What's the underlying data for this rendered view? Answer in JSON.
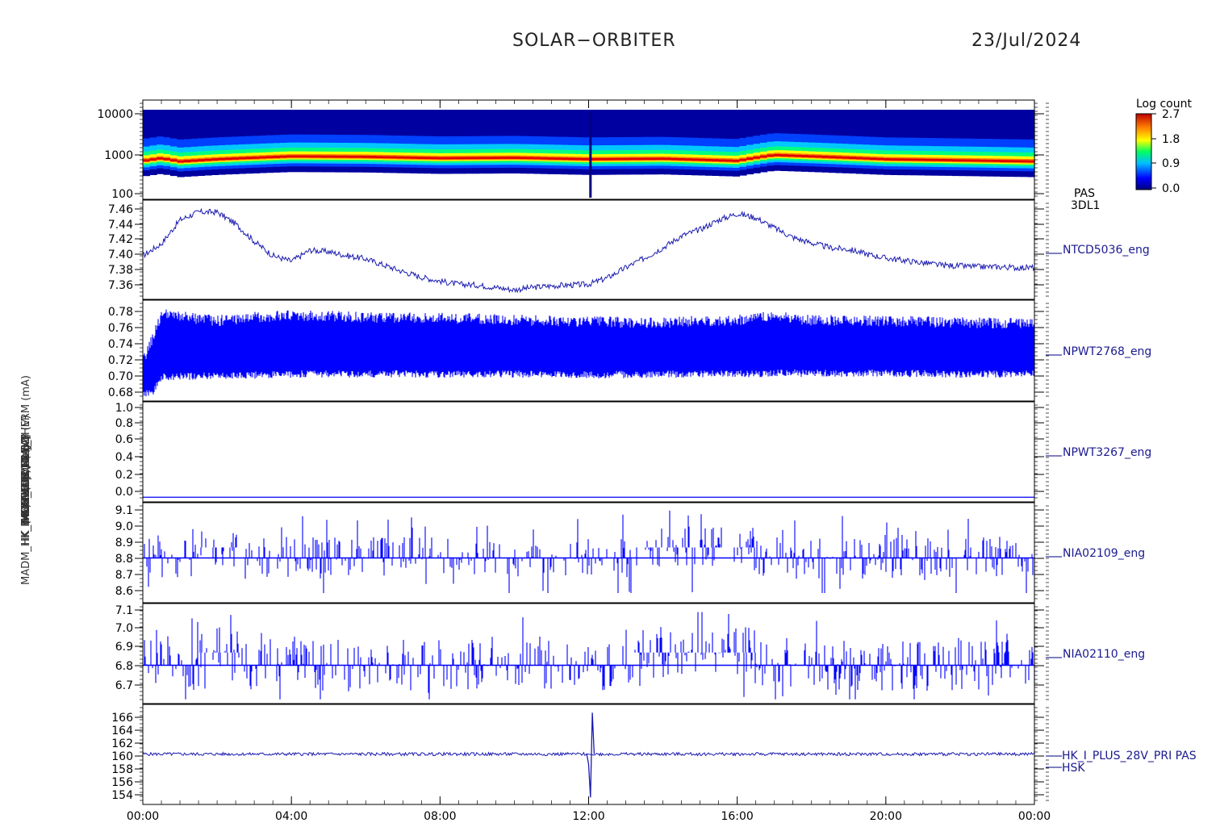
{
  "header": {
    "mission": "SOLAR−ORBITER",
    "date": "23/Jul/2024"
  },
  "y_axis_labels": [
    "(eV)",
    "Flux Temp (DegC)",
    "SW HDS 1 (A)",
    "T ERPW FDB0 (A)",
    "VA SWA 2 / 1 / 2",
    "(nF) C 1 (V) 1 (V)",
    "HK_IMON_FDR MLE_P (V)",
    "MADM_HK_IMON_FDR MLE_THERM (mA)"
  ],
  "x_ticks": [
    "00:00",
    "04:00",
    "08:00",
    "12:00",
    "16:00",
    "20:00",
    "00:00"
  ],
  "colorbar": {
    "title": "Log count",
    "ticks": [
      "2.7",
      "1.8",
      "0.9",
      "0.0"
    ]
  },
  "chart_data": [
    {
      "type": "heatmap",
      "panel_labels": [
        "PAS",
        "3DL1"
      ],
      "yscale": "log",
      "ylim": [
        100,
        15000
      ],
      "yticks": [
        "10000",
        "1000",
        "100"
      ],
      "zlim": [
        0.0,
        2.7
      ],
      "xlim_hours": [
        0,
        24
      ],
      "peak_energy_eV": [
        {
          "x": 0.0,
          "y": 700
        },
        {
          "x": 0.5,
          "y": 800
        },
        {
          "x": 1.0,
          "y": 680
        },
        {
          "x": 2.0,
          "y": 760
        },
        {
          "x": 4.0,
          "y": 880
        },
        {
          "x": 6.0,
          "y": 860
        },
        {
          "x": 8.0,
          "y": 800
        },
        {
          "x": 10.0,
          "y": 820
        },
        {
          "x": 12.0,
          "y": 760
        },
        {
          "x": 14.0,
          "y": 780
        },
        {
          "x": 16.0,
          "y": 700
        },
        {
          "x": 17.0,
          "y": 940
        },
        {
          "x": 20.0,
          "y": 760
        },
        {
          "x": 24.0,
          "y": 680
        }
      ],
      "color": "#000080"
    },
    {
      "type": "line",
      "panel_label": "NTCD5036_eng",
      "ylim": [
        7.345,
        7.47
      ],
      "yticks": [
        "7.46",
        "7.44",
        "7.42",
        "7.40",
        "7.38",
        "7.36"
      ],
      "series": [
        {
          "color": "#1a1ab0",
          "x": [
            0.0,
            0.5,
            1.0,
            1.5,
            2.0,
            2.5,
            3.0,
            3.5,
            4.0,
            4.5,
            5.0,
            5.5,
            6.0,
            6.5,
            7.0,
            7.5,
            8.0,
            8.5,
            9.0,
            9.5,
            10.0,
            10.5,
            11.0,
            11.5,
            12.0,
            12.5,
            13.0,
            13.5,
            14.0,
            14.5,
            15.0,
            15.5,
            16.0,
            16.5,
            17.0,
            17.5,
            18.0,
            18.5,
            19.0,
            19.5,
            20.0,
            20.5,
            21.0,
            21.5,
            22.0,
            22.5,
            23.0,
            23.5,
            24.0
          ],
          "values": [
            7.4,
            7.415,
            7.445,
            7.455,
            7.455,
            7.44,
            7.418,
            7.4,
            7.393,
            7.407,
            7.405,
            7.4,
            7.396,
            7.388,
            7.38,
            7.373,
            7.368,
            7.364,
            7.363,
            7.36,
            7.357,
            7.36,
            7.362,
            7.363,
            7.364,
            7.372,
            7.385,
            7.397,
            7.41,
            7.425,
            7.433,
            7.445,
            7.453,
            7.448,
            7.435,
            7.423,
            7.416,
            7.41,
            7.408,
            7.402,
            7.397,
            7.394,
            7.391,
            7.388,
            7.387,
            7.386,
            7.386,
            7.385,
            7.385
          ]
        }
      ]
    },
    {
      "type": "line",
      "panel_label": "NPWT2768_eng",
      "ylim": [
        0.675,
        0.785
      ],
      "yticks": [
        "0.78",
        "0.76",
        "0.74",
        "0.72",
        "0.70",
        "0.68"
      ],
      "series": [
        {
          "color": "#0000ff",
          "band_x": [
            0.0,
            0.25,
            0.5,
            2.0,
            3.0,
            4.0,
            6.0,
            8.0,
            10.0,
            12.0,
            14.0,
            16.0,
            17.0,
            18.0,
            20.0,
            22.0,
            24.0
          ],
          "band_low": [
            0.685,
            0.685,
            0.703,
            0.704,
            0.705,
            0.706,
            0.706,
            0.706,
            0.706,
            0.705,
            0.706,
            0.706,
            0.707,
            0.707,
            0.707,
            0.706,
            0.706
          ],
          "band_high": [
            0.715,
            0.74,
            0.767,
            0.76,
            0.764,
            0.766,
            0.764,
            0.763,
            0.761,
            0.759,
            0.758,
            0.761,
            0.765,
            0.761,
            0.76,
            0.758,
            0.757
          ]
        }
      ]
    },
    {
      "type": "line",
      "panel_label": "NPWT3267_eng",
      "ylim": [
        -0.05,
        1.03
      ],
      "yticks": [
        "1.0",
        "0.8",
        "0.6",
        "0.4",
        "0.2",
        "0.0"
      ],
      "series": [
        {
          "color": "#0000ff",
          "x": [
            0,
            24
          ],
          "values": [
            0.0,
            0.0
          ]
        }
      ]
    },
    {
      "type": "line",
      "panel_label": "NIA02109_eng",
      "ylim": [
        8.545,
        9.115
      ],
      "yticks": [
        "9.1",
        "9.0",
        "8.9",
        "8.8",
        "8.7",
        "8.6"
      ],
      "series": [
        {
          "color": "#0000ff",
          "baseline": 8.8,
          "range": [
            8.6,
            9.07
          ]
        }
      ]
    },
    {
      "type": "line",
      "panel_label": "NIA02110_eng",
      "ylim": [
        6.64,
        7.11
      ],
      "yticks": [
        "7.1",
        "7.0",
        "6.9",
        "6.8",
        "6.7"
      ],
      "series": [
        {
          "color": "#0000ff",
          "baseline": 6.82,
          "range": [
            6.66,
            7.07
          ]
        }
      ]
    },
    {
      "type": "line",
      "panel_labels": [
        "HK_I_PLUS_28V_PRI PAS",
        "HSK"
      ],
      "ylim": [
        153,
        167.5
      ],
      "yticks": [
        "166",
        "164",
        "162",
        "160",
        "158",
        "156",
        "154"
      ],
      "series": [
        {
          "color": "#1a1ab0",
          "x": [
            0,
            11.95,
            12.0,
            12.05,
            12.1,
            12.15,
            24
          ],
          "values": [
            160.3,
            160.3,
            158.8,
            154.0,
            166.3,
            160.3,
            160.3
          ]
        }
      ]
    }
  ]
}
